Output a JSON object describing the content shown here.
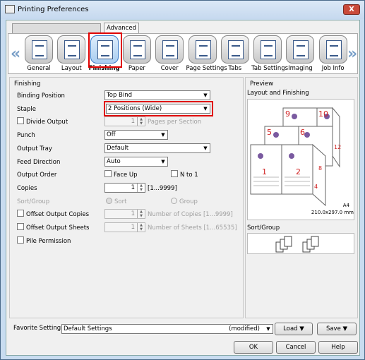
{
  "window": {
    "title": "Printing Preferences",
    "close": "X"
  },
  "tabs": {
    "blank": "",
    "advanced": "Advanced"
  },
  "nav": {
    "left": "«",
    "right": "»"
  },
  "categories": [
    {
      "label": "General",
      "icon": "general-icon"
    },
    {
      "label": "Layout",
      "icon": "layout-icon"
    },
    {
      "label": "Finishing",
      "icon": "finishing-icon",
      "selected": true
    },
    {
      "label": "Paper",
      "icon": "paper-icon"
    },
    {
      "label": "Cover",
      "icon": "cover-icon"
    },
    {
      "label": "Page Settings",
      "icon": "page-settings-icon"
    },
    {
      "label": "Tabs",
      "icon": "tabs-icon"
    },
    {
      "label": "Tab Settings",
      "icon": "tab-settings-icon"
    },
    {
      "label": "Imaging",
      "icon": "imaging-icon"
    },
    {
      "label": "Job Info",
      "icon": "job-info-icon"
    }
  ],
  "finishing": {
    "title": "Finishing",
    "binding_label": "Binding Position",
    "binding_value": "Top Bind",
    "staple_label": "Staple",
    "staple_value": "2 Positions (Wide)",
    "divide_label": "Divide Output",
    "divide_value": "1",
    "divide_unit": "Pages per Section",
    "punch_label": "Punch",
    "punch_value": "Off",
    "tray_label": "Output Tray",
    "tray_value": "Default",
    "feed_label": "Feed Direction",
    "feed_value": "Auto",
    "order_label": "Output Order",
    "faceup": "Face Up",
    "nto1": "N to 1",
    "copies_label": "Copies",
    "copies_value": "1",
    "copies_range": "[1...9999]",
    "sort_label": "Sort/Group",
    "sort": "Sort",
    "group": "Group",
    "offset_copies_label": "Offset Output Copies",
    "offset_copies_value": "1",
    "offset_copies_unit": "Number of Copies [1...9999]",
    "offset_sheets_label": "Offset Output Sheets",
    "offset_sheets_value": "1",
    "offset_sheets_unit": "Number of Sheets [1...65535]",
    "pile_label": "Pile Permission"
  },
  "preview": {
    "title": "Preview",
    "layout_title": "Layout and Finishing",
    "paper_size": "A4",
    "paper_dims": "210.0x297.0 mm",
    "sortgroup_title": "Sort/Group",
    "pages": [
      "9",
      "10",
      "5",
      "6",
      "1",
      "2",
      "12",
      "8",
      "4"
    ]
  },
  "footer": {
    "fav_label": "Favorite Setting",
    "fav_value": "Default Settings",
    "modified": "(modified)",
    "load": "Load",
    "save": "Save",
    "ok": "OK",
    "cancel": "Cancel",
    "help": "Help"
  }
}
